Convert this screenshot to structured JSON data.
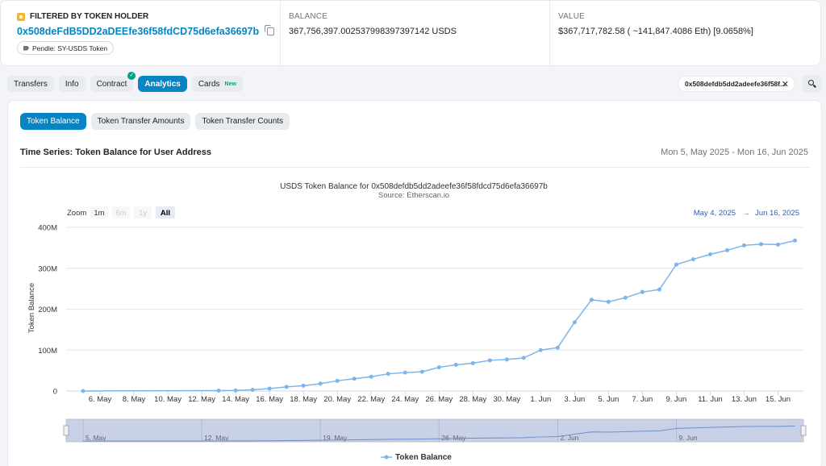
{
  "header": {
    "filter_label": "FILTERED BY TOKEN HOLDER",
    "address": "0x508deFdB5DD2aDEEfe36f58fdCD75d6efa36697b",
    "tag": "Pendle: SY-USDS Token",
    "balance_label": "BALANCE",
    "balance_value": "367,756,397.002537998397397142 USDS",
    "value_label": "VALUE",
    "value_value": "$367,717,782.58 ( ~141,847.4086 Eth) [9.0658%]"
  },
  "tabs": [
    {
      "label": "Transfers"
    },
    {
      "label": "Info"
    },
    {
      "label": "Contract"
    },
    {
      "label": "Analytics"
    },
    {
      "label": "Cards",
      "badge": "New"
    }
  ],
  "filter_chip": {
    "text": "0x508defdb5dd2adeefe36f58f...",
    "close": "✕"
  },
  "subtabs": [
    {
      "label": "Token Balance"
    },
    {
      "label": "Token Transfer Amounts"
    },
    {
      "label": "Token Transfer Counts"
    }
  ],
  "timeseries": {
    "title": "Time Series: Token Balance for User Address",
    "range": "Mon 5, May 2025 - Mon 16, Jun 2025"
  },
  "chart": {
    "zoom_label": "Zoom",
    "zoom_options": [
      "1m",
      "6m",
      "1y",
      "All"
    ],
    "from_date": "May 4, 2025",
    "arrow": "→",
    "to_date": "Jun 16, 2025",
    "navigator_labels": [
      "5. May",
      "12. May",
      "19. May",
      "26. May",
      "2. Jun",
      "9. Jun"
    ]
  },
  "chart_data": {
    "type": "line",
    "title": "USDS Token Balance for 0x508defdb5dd2adeefe36f58fdcd75d6efa36697b",
    "subtitle": "Source: Etherscan.io",
    "xlabel": "",
    "ylabel": "Token Balance",
    "ylim": [
      0,
      400000000
    ],
    "y_ticks": [
      "0",
      "100M",
      "200M",
      "300M",
      "400M"
    ],
    "x_ticks": [
      "6. May",
      "8. May",
      "10. May",
      "12. May",
      "14. May",
      "16. May",
      "18. May",
      "20. May",
      "22. May",
      "24. May",
      "26. May",
      "28. May",
      "30. May",
      "1. Jun",
      "3. Jun",
      "5. Jun",
      "7. Jun",
      "9. Jun",
      "11. Jun",
      "13. Jun",
      "15. Jun"
    ],
    "grid": true,
    "legend": "bottom",
    "series": [
      {
        "name": "Token Balance",
        "color": "#7cb5ec",
        "x": [
          "2025-05-05",
          "2025-05-13",
          "2025-05-14",
          "2025-05-15",
          "2025-05-16",
          "2025-05-17",
          "2025-05-18",
          "2025-05-19",
          "2025-05-20",
          "2025-05-21",
          "2025-05-22",
          "2025-05-23",
          "2025-05-24",
          "2025-05-25",
          "2025-05-26",
          "2025-05-27",
          "2025-05-28",
          "2025-05-29",
          "2025-05-30",
          "2025-05-31",
          "2025-06-01",
          "2025-06-02",
          "2025-06-03",
          "2025-06-04",
          "2025-06-05",
          "2025-06-06",
          "2025-06-07",
          "2025-06-08",
          "2025-06-09",
          "2025-06-10",
          "2025-06-11",
          "2025-06-12",
          "2025-06-13",
          "2025-06-14",
          "2025-06-15",
          "2025-06-16"
        ],
        "values": [
          0,
          1000000,
          1500000,
          3000000,
          6000000,
          10000000,
          13000000,
          18000000,
          25000000,
          30000000,
          35000000,
          42000000,
          45000000,
          47000000,
          58000000,
          64000000,
          68000000,
          75000000,
          77000000,
          81000000,
          100000000,
          106000000,
          168000000,
          223000000,
          218000000,
          228000000,
          242000000,
          248000000,
          309000000,
          322000000,
          334000000,
          344000000,
          356000000,
          359000000,
          358000000,
          367756397
        ]
      }
    ]
  }
}
